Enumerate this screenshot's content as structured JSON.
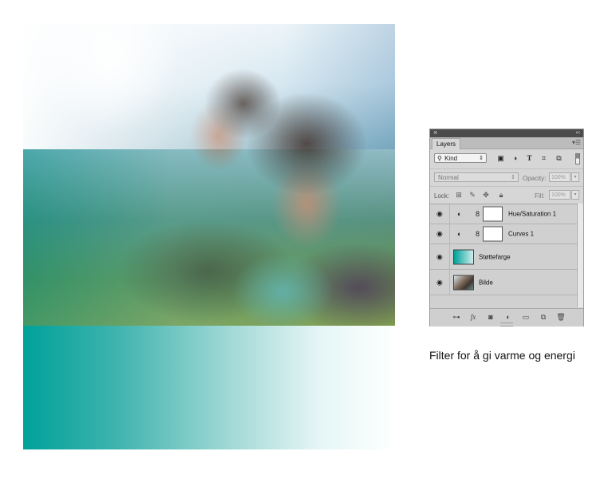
{
  "panel": {
    "title": "Layers",
    "filter": {
      "kind_label": "Kind"
    },
    "blend_mode": "Normal",
    "opacity_label": "Opacity:",
    "opacity_value": "100%",
    "lock_label": "Lock:",
    "fill_label": "Fill:",
    "fill_value": "100%",
    "layers": [
      {
        "name": "Hue/Saturation 1",
        "type": "adjustment",
        "visible": true
      },
      {
        "name": "Curves 1",
        "type": "adjustment",
        "visible": true
      },
      {
        "name": "Støttefarge",
        "type": "fill",
        "visible": true
      },
      {
        "name": "Bilde",
        "type": "image",
        "visible": true
      }
    ]
  },
  "caption": "Filter for å gi varme og energi",
  "colors": {
    "teal": "#00a19a",
    "panel_bg": "#d6d6d6",
    "panel_header": "#4b4b4b"
  }
}
